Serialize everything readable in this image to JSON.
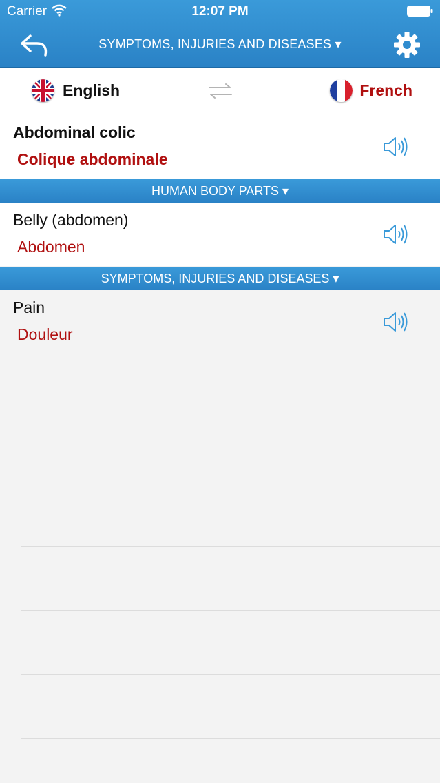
{
  "status_bar": {
    "carrier": "Carrier",
    "time": "12:07 PM"
  },
  "nav": {
    "title": "SYMPTOMS, INJURIES AND DISEASES ▾",
    "back_icon": "back-arrow-icon",
    "settings_icon": "gear-icon"
  },
  "languages": {
    "source": {
      "name": "English",
      "flag": "uk-flag-icon"
    },
    "target": {
      "name": "French",
      "flag": "france-flag-icon"
    },
    "swap_icon": "swap-arrows-icon"
  },
  "entries": [
    {
      "term": "Abdominal colic",
      "translation": "Colique abdominale"
    },
    {
      "term": "Belly (abdomen)",
      "translation": "Abdomen"
    },
    {
      "term": "Pain",
      "translation": "Douleur"
    }
  ],
  "sections": [
    {
      "label": "HUMAN BODY PARTS ▾"
    },
    {
      "label": "SYMPTOMS, INJURIES AND DISEASES ▾"
    }
  ],
  "colors": {
    "accent_blue": "#2a82c6",
    "translation_red": "#b01010",
    "speaker_blue": "#3a9ad9"
  }
}
